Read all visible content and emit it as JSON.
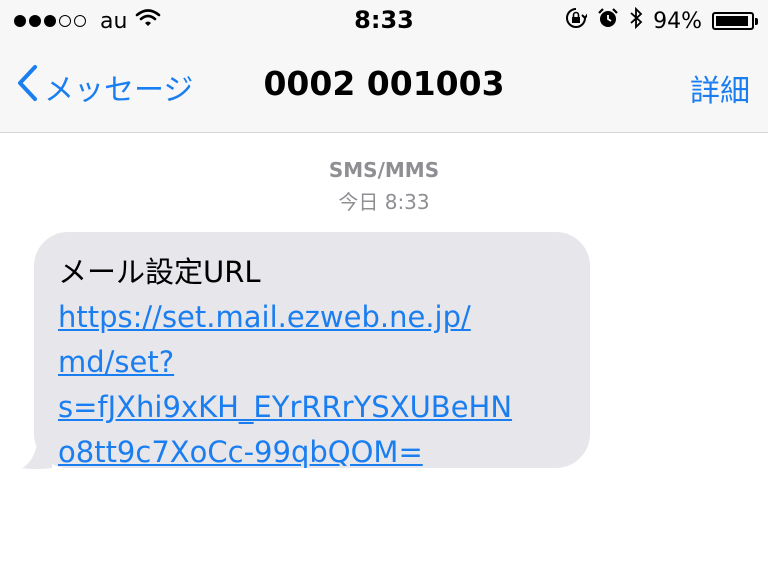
{
  "status_bar": {
    "signal_filled": 3,
    "signal_total": 5,
    "carrier": "au",
    "time": "8:33",
    "battery_pct": "94%",
    "battery_level": 0.94,
    "icons": [
      "wifi-icon",
      "screen-lock-icon",
      "alarm-icon",
      "bluetooth-icon",
      "battery-icon"
    ]
  },
  "nav": {
    "back_label": "メッセージ",
    "title": "0002 001003",
    "details_label": "詳細"
  },
  "conversation": {
    "service": "SMS/MMS",
    "timestamp": "今日 8:33",
    "message": {
      "label": "メール設定URL",
      "link_lines": [
        "https://set.mail.ezweb.ne.jp/",
        "md/set?",
        "s=fJXhi9xKH_EYrRRrYSXUBeHN",
        "o8tt9c7XoCc-99qbQOM="
      ]
    }
  },
  "colors": {
    "accent": "#1a7ef0",
    "bubble": "#e6e6eb",
    "meta_text": "#8e8e93",
    "bar_background": "#f7f7f7"
  }
}
